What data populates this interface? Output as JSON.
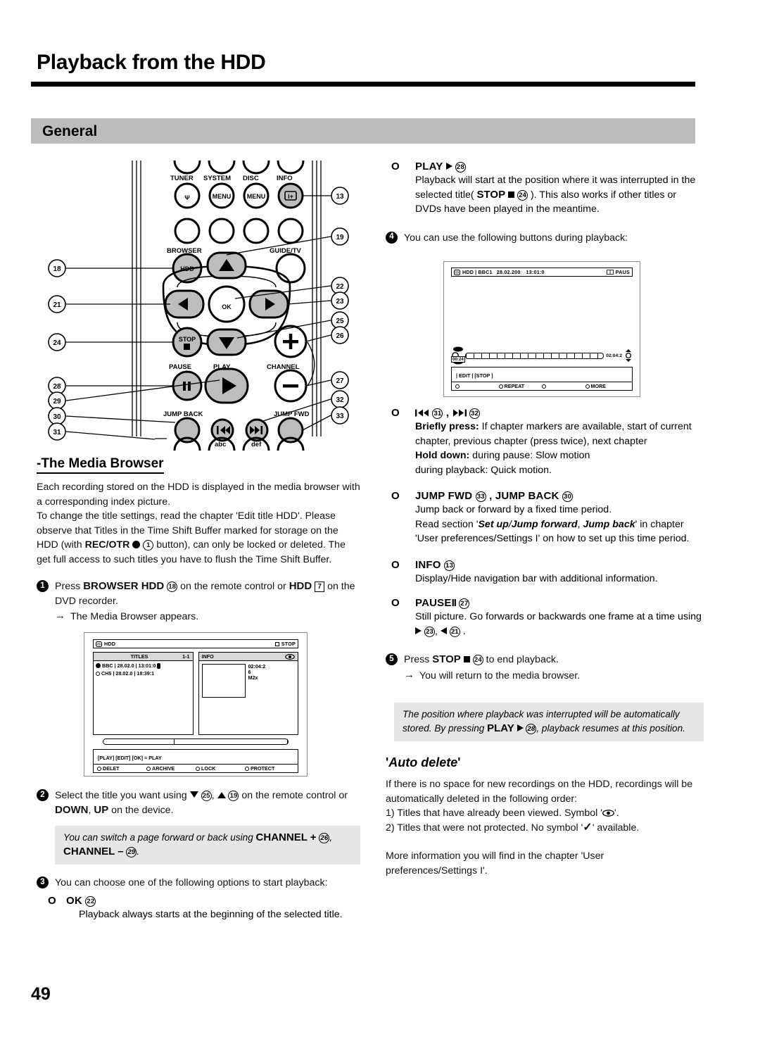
{
  "header": {
    "title": "Playback from the HDD",
    "section": "General"
  },
  "page_number": "49",
  "remote": {
    "button_labels": [
      "TUNER",
      "SYSTEM",
      "DISC",
      "INFO",
      "BROWSER",
      "GUIDE/TV",
      "PAUSE",
      "PLAY",
      "CHANNEL",
      "JUMP BACK",
      "JUMP FWD",
      "abc",
      "def"
    ],
    "key_caps": {
      "hdd": "HDD",
      "ok": "OK",
      "stop": "STOP",
      "menu": "MENU"
    },
    "callouts_left": [
      "18",
      "21",
      "24",
      "28",
      "29",
      "30",
      "31"
    ],
    "callouts_right": [
      "13",
      "19",
      "22",
      "23",
      "25",
      "26",
      "27",
      "32",
      "33"
    ]
  },
  "left": {
    "media_browser_heading": "-The Media Browser",
    "intro_p1": "Each recording stored on the HDD is displayed in the media browser with a corresponding index picture.",
    "intro_p2_a": "To change the title settings, read the chapter 'Edit title HDD'. Please observe that Titles in the Time Shift Buffer marked for storage on the HDD (with ",
    "intro_p2_rec": "REC/OTR",
    "intro_p2_ref": "1",
    "intro_p2_b": " button), can only be locked or deleted. The get full access to such titles you have to flush the Time Shift Buffer.",
    "step1_num": "1",
    "step1_a": "Press ",
    "step1_browser": "BROWSER HDD",
    "step1_ref18": "18",
    "step1_b": " on the remote control or ",
    "step1_hdd": "HDD",
    "step1_ref7": "7",
    "step1_c": " on the DVD recorder.",
    "step1_arrow": "The Media Browser appears.",
    "step2_num": "2",
    "step2_a": "Select the title you want using ",
    "step2_ref25": "25",
    "step2_b": ", ",
    "step2_ref19": "19",
    "step2_c": " on the remote control or ",
    "step2_down": "DOWN",
    "step2_d": ", ",
    "step2_up": "UP",
    "step2_e": " on the device.",
    "note_a": "You can switch a page forward or back using ",
    "note_ch_plus": "CHANNEL +",
    "note_ref26": "26",
    "note_b": ", ",
    "note_ch_minus": "CHANNEL –",
    "note_ref29": "29",
    "note_c": ".",
    "step3_num": "3",
    "step3_text": "You can choose one of the following options to start playback:",
    "opt_ok_label": "OK",
    "opt_ok_ref": "22",
    "opt_ok_body": "Playback always starts at the beginning of the selected title."
  },
  "media_browser_screen": {
    "top_left": "HDD",
    "top_right": "STOP",
    "titles_header": "TITLES",
    "titles_page": "1-1",
    "info_header": "INFO",
    "rows": [
      {
        "channel": "BBC",
        "date": "28.02.0",
        "time": "13:01:0",
        "selected": true
      },
      {
        "channel": "CH5",
        "date": "28.02.0",
        "time": "18:39:1",
        "selected": false
      }
    ],
    "info_lines": [
      "02:04:2",
      "6",
      "M2x"
    ],
    "cmd_bar": "[PLAY] [EDIT] [OK]  = PLAY",
    "actions": [
      "DELET",
      "ARCHIVE",
      "LOCK",
      "PROTECT"
    ]
  },
  "right": {
    "opt_play_label": "PLAY",
    "opt_play_ref": "28",
    "opt_play_body_a": "Playback will start at the position where it was interrupted in the selected title( ",
    "opt_play_stop": "STOP",
    "opt_play_ref24": "24",
    "opt_play_body_b": " ). This also works if other titles or DVDs have been played in the meantime.",
    "step4_num": "4",
    "step4_text": "You can use the following buttons during playback:",
    "opt_skip_ref31": "31",
    "opt_skip_ref32": "32",
    "opt_skip_brief_label": "Briefly press:",
    "opt_skip_brief_body": " If chapter markers are available, start of current chapter, previous chapter (press twice), next chapter",
    "opt_skip_hold_label": "Hold down:",
    "opt_skip_hold_body": " during pause: Slow motion",
    "opt_skip_hold_body2": "during playback: Quick motion.",
    "opt_jump_label_a": "JUMP FWD",
    "opt_jump_ref33": "33",
    "opt_jump_label_b": "JUMP BACK",
    "opt_jump_ref30": "30",
    "opt_jump_body1": "Jump back or forward by a fixed time period.",
    "opt_jump_body2_a": "Read section '",
    "opt_jump_setup": "Set up",
    "opt_jump_slash": "/",
    "opt_jump_fwd": "Jump forward",
    "opt_jump_comma": ", ",
    "opt_jump_back": "Jump back",
    "opt_jump_body2_b": "' in chapter 'User preferences/Settings I' on how to set up this time period.",
    "opt_info_label": "INFO",
    "opt_info_ref": "13",
    "opt_info_body": "Display/Hide navigation bar with additional information.",
    "opt_pause_label": "PAUSE",
    "opt_pause_ref": "27",
    "opt_pause_body_a": "Still picture. Go forwards or backwards one frame at a time using ",
    "opt_pause_ref23": "23",
    "opt_pause_comma": ", ",
    "opt_pause_ref21": "21",
    "opt_pause_dot": ".",
    "step5_num": "5",
    "step5_a": "Press ",
    "step5_stop": "STOP",
    "step5_ref24": "24",
    "step5_b": " to end playback.",
    "step5_arrow": "You will return to the media browser.",
    "note2_a": "The position where playback was interrupted will be automatically stored. By pressing ",
    "note2_play": "PLAY",
    "note2_ref28": "28",
    "note2_b": ", playback resumes at this position.",
    "autodelete_heading_q1": "'",
    "autodelete_heading": "Auto delete",
    "autodelete_heading_q2": "'",
    "autodelete_p1": "If there is no space for new recordings on the HDD, recordings will be automatically deleted in the following order:",
    "autodelete_l1_a": "1) Titles that have already been viewed. Symbol '",
    "autodelete_l1_b": "'.",
    "autodelete_l2_a": "2) Titles that were not protected. No symbol '",
    "autodelete_l2_check": "✓",
    "autodelete_l2_b": "' available.",
    "autodelete_p2": "More information you will find in the chapter 'User preferences/Settings I'."
  },
  "playback_osd": {
    "src": "HDD",
    "channel": "BBC1",
    "date": "28.02.200",
    "time": "13:01:0",
    "status": "PAUS",
    "elapsed": "00:24",
    "total": "02:04:2",
    "cmd_bar": "| EDIT |  [STOP ]",
    "actions": [
      "",
      "REPEAT",
      "",
      "MORE"
    ]
  }
}
